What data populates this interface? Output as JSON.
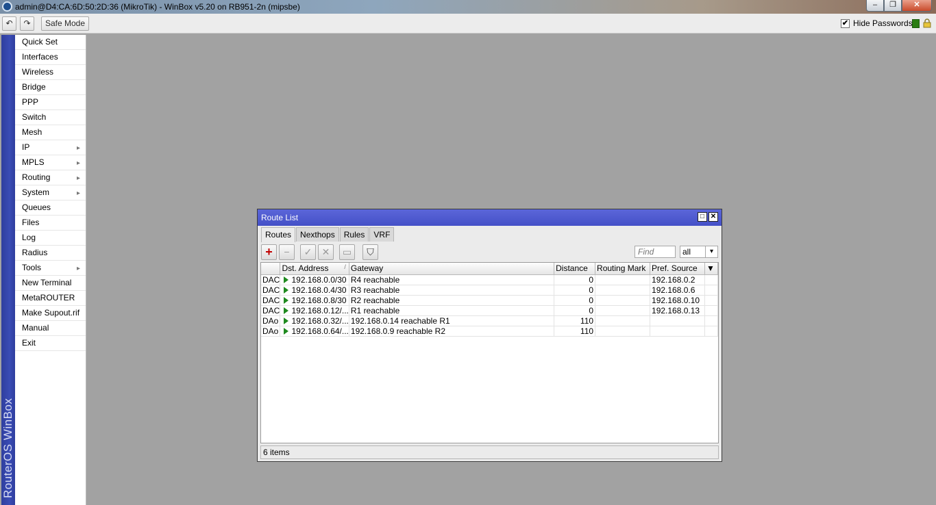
{
  "window": {
    "title": "admin@D4:CA:6D:50:2D:36 (MikroTik) - WinBox v5.20 on RB951-2n (mipsbe)",
    "minimize": "‒",
    "restore": "❐",
    "close": "✕"
  },
  "toolbar": {
    "undo_icon": "↶",
    "redo_icon": "↷",
    "safe_mode": "Safe Mode",
    "hide_passwords_label": "Hide Passwords",
    "hide_passwords_checked": "✔"
  },
  "sidebar": {
    "brand": "RouterOS WinBox",
    "items": [
      {
        "label": "Quick Set",
        "sub": ""
      },
      {
        "label": "Interfaces",
        "sub": ""
      },
      {
        "label": "Wireless",
        "sub": ""
      },
      {
        "label": "Bridge",
        "sub": ""
      },
      {
        "label": "PPP",
        "sub": ""
      },
      {
        "label": "Switch",
        "sub": ""
      },
      {
        "label": "Mesh",
        "sub": ""
      },
      {
        "label": "IP",
        "sub": "▸"
      },
      {
        "label": "MPLS",
        "sub": "▸"
      },
      {
        "label": "Routing",
        "sub": "▸"
      },
      {
        "label": "System",
        "sub": "▸"
      },
      {
        "label": "Queues",
        "sub": ""
      },
      {
        "label": "Files",
        "sub": ""
      },
      {
        "label": "Log",
        "sub": ""
      },
      {
        "label": "Radius",
        "sub": ""
      },
      {
        "label": "Tools",
        "sub": "▸"
      },
      {
        "label": "New Terminal",
        "sub": ""
      },
      {
        "label": "MetaROUTER",
        "sub": ""
      },
      {
        "label": "Make Supout.rif",
        "sub": ""
      },
      {
        "label": "Manual",
        "sub": ""
      },
      {
        "label": "Exit",
        "sub": ""
      }
    ]
  },
  "route_list": {
    "title": "Route List",
    "max_icon": "□",
    "close_icon": "✕",
    "tabs": [
      "Routes",
      "Nexthops",
      "Rules",
      "VRF"
    ],
    "buttons": {
      "add": "+",
      "remove": "−",
      "enable": "✓",
      "disable": "✕",
      "comment": "▭",
      "filter": "⛉"
    },
    "find_placeholder": "Find",
    "filter_value": "all",
    "filter_dd": "▾",
    "columns": [
      "",
      "Dst. Address",
      "Gateway",
      "Distance",
      "Routing Mark",
      "Pref. Source",
      "▼"
    ],
    "sort_mark": "/",
    "rows": [
      {
        "flags": "DAC",
        "dst": "192.168.0.0/30",
        "gateway": "R4 reachable",
        "distance": "0",
        "mark": "",
        "pref_src": "192.168.0.2"
      },
      {
        "flags": "DAC",
        "dst": "192.168.0.4/30",
        "gateway": "R3 reachable",
        "distance": "0",
        "mark": "",
        "pref_src": "192.168.0.6"
      },
      {
        "flags": "DAC",
        "dst": "192.168.0.8/30",
        "gateway": "R2 reachable",
        "distance": "0",
        "mark": "",
        "pref_src": "192.168.0.10"
      },
      {
        "flags": "DAC",
        "dst": "192.168.0.12/...",
        "gateway": "R1 reachable",
        "distance": "0",
        "mark": "",
        "pref_src": "192.168.0.13"
      },
      {
        "flags": "DAo",
        "dst": "192.168.0.32/...",
        "gateway": "192.168.0.14 reachable R1",
        "distance": "110",
        "mark": "",
        "pref_src": ""
      },
      {
        "flags": "DAo",
        "dst": "192.168.0.64/...",
        "gateway": "192.168.0.9 reachable R2",
        "distance": "110",
        "mark": "",
        "pref_src": ""
      }
    ],
    "status": "6 items"
  }
}
